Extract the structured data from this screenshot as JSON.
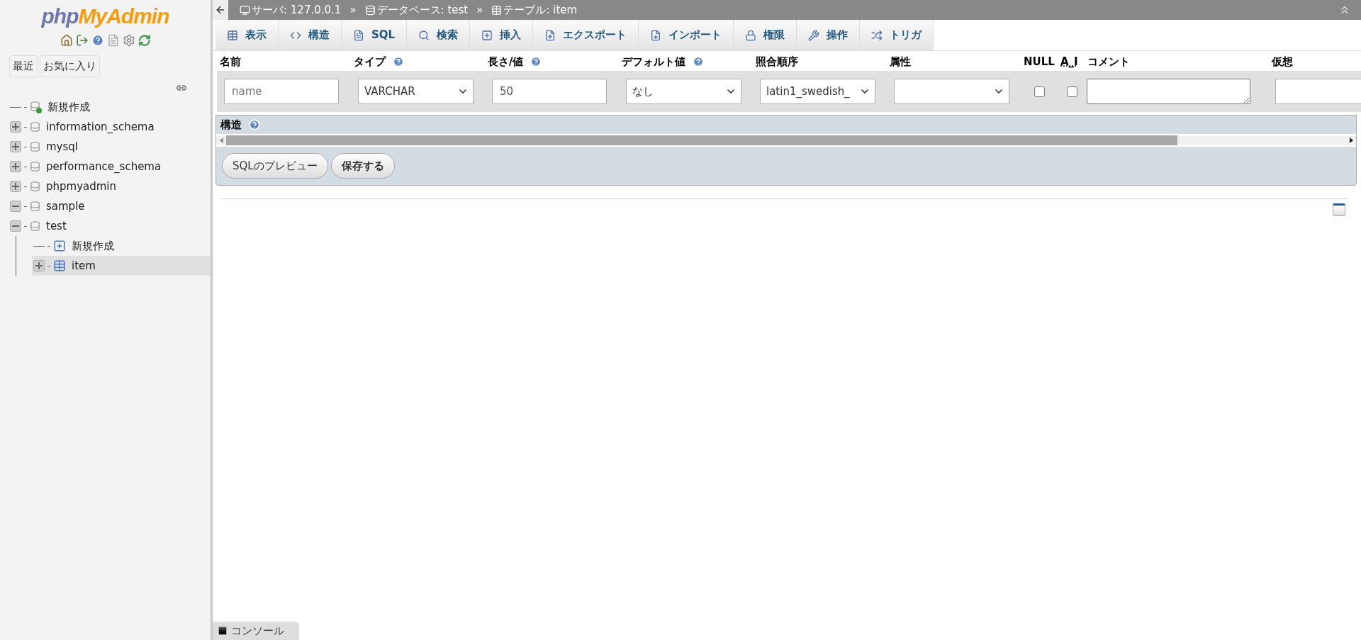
{
  "sidebar": {
    "logo": {
      "part_1": "php",
      "part_2": "MyAdmin"
    },
    "buttons": [
      {
        "label": "最近"
      },
      {
        "label": "お気に入り"
      }
    ],
    "tree": [
      {
        "label": "新規作成",
        "kind": "new",
        "selected": false
      },
      {
        "label": "information_schema",
        "kind": "db",
        "expanded": false,
        "selected": false
      },
      {
        "label": "mysql",
        "kind": "db",
        "expanded": false,
        "selected": false
      },
      {
        "label": "performance_schema",
        "kind": "db",
        "expanded": false,
        "selected": false
      },
      {
        "label": "phpmyadmin",
        "kind": "db",
        "expanded": false,
        "selected": false
      },
      {
        "label": "sample",
        "kind": "db",
        "expanded": true,
        "selected": false
      },
      {
        "label": "test",
        "kind": "db",
        "expanded": true,
        "selected": false,
        "children": [
          {
            "label": "新規作成",
            "kind": "newtable",
            "selected": false
          },
          {
            "label": "item",
            "kind": "table",
            "expanded": false,
            "selected": true
          }
        ]
      }
    ]
  },
  "breadcrumb": [
    {
      "label": "サーバ: 127.0.0.1",
      "kind": "server"
    },
    {
      "label": "データベース: test",
      "kind": "db"
    },
    {
      "label": "テーブル: item",
      "kind": "table"
    }
  ],
  "breadcrumb_separator": "»",
  "tabs": [
    {
      "label": "表示",
      "kind": "browse",
      "selected": false
    },
    {
      "label": "構造",
      "kind": "structure",
      "selected": false
    },
    {
      "label": "SQL",
      "kind": "sql",
      "selected": false
    },
    {
      "label": "検索",
      "kind": "search",
      "selected": false
    },
    {
      "label": "挿入",
      "kind": "insert",
      "selected": false
    },
    {
      "label": "エクスポート",
      "kind": "export",
      "selected": false
    },
    {
      "label": "インポート",
      "kind": "import",
      "selected": false
    },
    {
      "label": "権限",
      "kind": "privileges",
      "selected": false
    },
    {
      "label": "操作",
      "kind": "operations",
      "selected": false
    },
    {
      "label": "トリガ",
      "kind": "triggers",
      "selected": false
    }
  ],
  "columns": [
    {
      "label": "名前",
      "help": false,
      "abbreviated": false
    },
    {
      "label": "タイプ",
      "help": true,
      "abbreviated": false
    },
    {
      "label": "長さ/値",
      "help": true,
      "abbreviated": false
    },
    {
      "label": "デフォルト値",
      "help": true,
      "abbreviated": false
    },
    {
      "label": "照合順序",
      "help": false,
      "abbreviated": false
    },
    {
      "label": "属性",
      "help": false,
      "abbreviated": false
    },
    {
      "label": "NULL",
      "help": false,
      "abbreviated": false
    },
    {
      "label": "A_I",
      "help": false,
      "abbreviated": true
    },
    {
      "label": "コメント",
      "help": false,
      "abbreviated": false
    },
    {
      "label": "仮想",
      "help": false,
      "abbreviated": false
    }
  ],
  "field_row": [
    {
      "kind": "text",
      "placeholder": "name"
    },
    {
      "kind": "select",
      "value": "VARCHAR"
    },
    {
      "kind": "text",
      "value": "50"
    },
    {
      "kind": "select",
      "value": "なし"
    },
    {
      "kind": "select",
      "value": "latin1_swedish_"
    },
    {
      "kind": "select"
    },
    {
      "kind": "checkbox",
      "checked": false
    },
    {
      "kind": "checkbox",
      "checked": false
    },
    {
      "kind": "textarea"
    },
    {
      "kind": "text"
    }
  ],
  "section": {
    "title": "構造",
    "help": true
  },
  "actions": [
    {
      "label": "SQLのプレビュー",
      "primary": false
    },
    {
      "label": "保存する",
      "primary": true
    }
  ],
  "console": {
    "label": "コンソール"
  }
}
